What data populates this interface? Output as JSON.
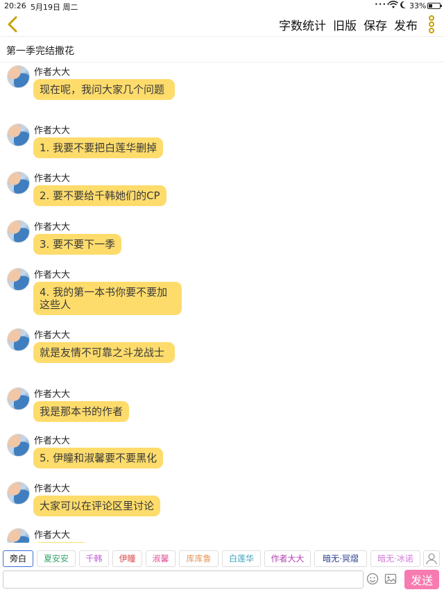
{
  "status_bar": {
    "time": "20:26",
    "date": "5月19日 周二",
    "signal": "••••",
    "battery_percent": "33%",
    "battery_level": 0.33
  },
  "nav": {
    "actions": [
      "字数统计",
      "旧版",
      "保存",
      "发布"
    ],
    "accent_color": "#c8a000"
  },
  "chapter": {
    "title": "第一季完结撒花"
  },
  "messages": [
    {
      "sender": "作者大大",
      "text": "现在呢，我问大家几个问题"
    },
    {
      "sender": "作者大大",
      "text": "1. 我要不要把白莲华删掉"
    },
    {
      "sender": "作者大大",
      "text": "2. 要不要给千韩她们的CP"
    },
    {
      "sender": "作者大大",
      "text": "3. 要不要下一季"
    },
    {
      "sender": "作者大大",
      "text": "4. 我的第一本书你要不要加这些人"
    },
    {
      "sender": "作者大大",
      "text": "就是友情不可靠之斗龙战士"
    },
    {
      "sender": "作者大大",
      "text": "我是那本书的作者"
    },
    {
      "sender": "作者大大",
      "text": "5. 伊瞳和淑馨要不要黑化"
    },
    {
      "sender": "作者大大",
      "text": "大家可以在评论区里讨论"
    },
    {
      "sender": "作者大大",
      "text": ""
    }
  ],
  "roles": [
    {
      "name": "旁白",
      "color": "#111111"
    },
    {
      "name": "夏安安",
      "color": "#3aa76d"
    },
    {
      "name": "千韩",
      "color": "#c05cd6"
    },
    {
      "name": "伊瞳",
      "color": "#d94a4a"
    },
    {
      "name": "淑馨",
      "color": "#e0569b"
    },
    {
      "name": "库库鲁",
      "color": "#e8965a"
    },
    {
      "name": "白莲华",
      "color": "#3a9fb8"
    },
    {
      "name": "作者大大",
      "color": "#b03fb0"
    },
    {
      "name": "暗无·冥熠",
      "color": "#2c3e8c"
    },
    {
      "name": "暗无·冰诺",
      "color": "#d27ad8"
    }
  ],
  "input": {
    "value": "",
    "send_label": "发送"
  }
}
